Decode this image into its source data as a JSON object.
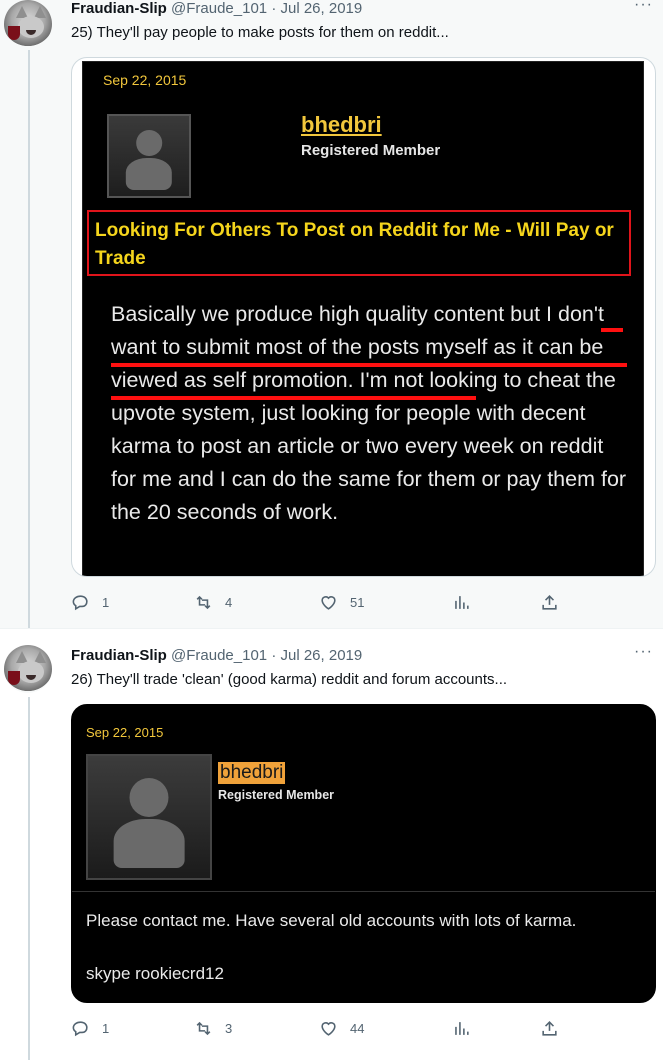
{
  "tweets": [
    {
      "author": {
        "name": "Fraudian-Slip",
        "handle": "@Fraude_101",
        "separator": "·",
        "date": "Jul 26, 2019"
      },
      "text": "25) They'll pay people to make posts for them on reddit...",
      "screenshot": {
        "date": "Sep 22, 2015",
        "username": "bhedbri",
        "role": "Registered Member",
        "post_title": "Looking For Others To Post on Reddit for Me - Will Pay or Trade",
        "body": "Basically we produce high quality content but I don't want to submit most of the posts myself as it can be viewed as self promotion. I'm not looking to cheat the upvote system, just looking for people with decent karma to post an article or two every week on reddit for me and I can do the same for them or pay them for the 20 seconds of work.",
        "highlight_color": "#ff1010"
      },
      "stats": {
        "replies": "1",
        "retweets": "4",
        "likes": "51"
      }
    },
    {
      "author": {
        "name": "Fraudian-Slip",
        "handle": "@Fraude_101",
        "separator": "·",
        "date": "Jul 26, 2019"
      },
      "text": "26) They'll trade 'clean' (good karma) reddit and forum accounts...",
      "screenshot": {
        "date": "Sep 22, 2015",
        "username": "bhedbri",
        "role": "Registered Member",
        "message_line1": "Please contact me. Have several old accounts with lots of karma.",
        "message_line2": "skype rookiecrd12"
      },
      "stats": {
        "replies": "1",
        "retweets": "3",
        "likes": "44"
      }
    }
  ],
  "icons": [
    "more-icon",
    "reply-icon",
    "retweet-icon",
    "like-icon",
    "views-icon",
    "share-icon",
    "person-icon"
  ],
  "colors": {
    "accent_text": "#536471",
    "forum_gold": "#f2c73c",
    "title_yellow": "#f5d51c",
    "title_border": "#e0141b",
    "username_highlight": "#f0a23a"
  }
}
